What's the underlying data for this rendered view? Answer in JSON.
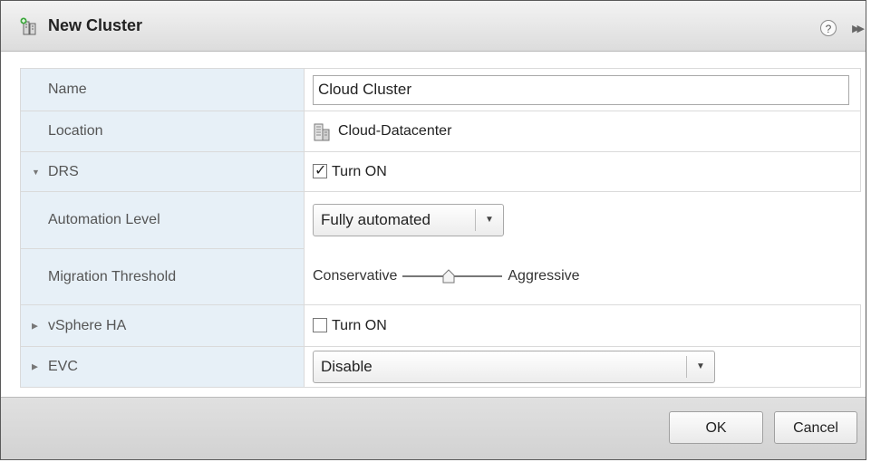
{
  "dialog": {
    "title": "New Cluster"
  },
  "form": {
    "name": {
      "label": "Name",
      "value": "Cloud Cluster"
    },
    "location": {
      "label": "Location",
      "value": "Cloud-Datacenter"
    },
    "drs": {
      "label": "DRS",
      "expanded": true,
      "checkbox_label": "Turn ON",
      "checked": true,
      "automation_level": {
        "label": "Automation Level",
        "value": "Fully automated"
      },
      "migration_threshold": {
        "label": "Migration Threshold",
        "min_label": "Conservative",
        "max_label": "Aggressive",
        "level_fraction": 0.45
      }
    },
    "vsphere_ha": {
      "label": "vSphere HA",
      "expanded": false,
      "checkbox_label": "Turn ON",
      "checked": false
    },
    "evc": {
      "label": "EVC",
      "expanded": false,
      "value": "Disable"
    }
  },
  "buttons": {
    "ok": "OK",
    "cancel": "Cancel"
  },
  "icons": {
    "title": "new-cluster-icon",
    "help": "help-icon",
    "expand": "double-chevron-right-icon",
    "location": "datacenter-icon",
    "expanded": "triangle-down-icon",
    "collapsed": "triangle-right-icon"
  },
  "help_glyph": "?"
}
